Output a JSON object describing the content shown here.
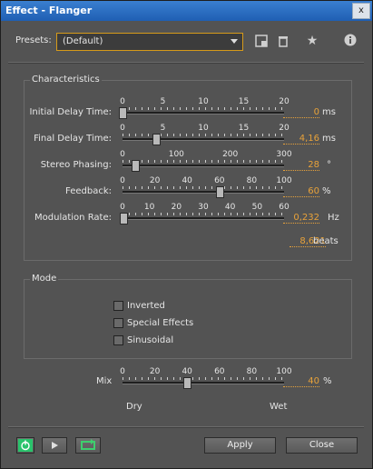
{
  "window": {
    "title": "Effect - Flanger",
    "close_glyph": "x"
  },
  "presets": {
    "label": "Presets:",
    "selected": "(Default)",
    "icons": [
      "save-preset-icon",
      "delete-preset-icon",
      "favorite-star-icon",
      "info-icon"
    ]
  },
  "characteristics": {
    "title": "Characteristics",
    "sliders": [
      {
        "label": "Initial Delay Time:",
        "ticks": [
          "0",
          "5",
          "10",
          "15",
          "20"
        ],
        "value": "0",
        "unit": "ms",
        "fraction": 0.0
      },
      {
        "label": "Final Delay Time:",
        "ticks": [
          "0",
          "5",
          "10",
          "15",
          "20"
        ],
        "value": "4,16",
        "unit": "ms",
        "fraction": 0.208
      },
      {
        "label": "Stereo Phasing:",
        "ticks": [
          "0",
          "100",
          "200",
          "300"
        ],
        "value": "28",
        "unit": "°",
        "fraction": 0.078
      },
      {
        "label": "Feedback:",
        "ticks": [
          "0",
          "20",
          "40",
          "60",
          "80",
          "100"
        ],
        "value": "60",
        "unit": "%",
        "fraction": 0.6
      },
      {
        "label": "Modulation Rate:",
        "ticks": [
          "0",
          "10",
          "20",
          "30",
          "40",
          "50",
          "60"
        ],
        "value": "0,232",
        "unit": "Hz",
        "fraction": 0.004
      }
    ],
    "beats_value": "8,621",
    "beats_unit": "beats"
  },
  "mode": {
    "title": "Mode",
    "options": [
      {
        "label": "Inverted",
        "checked": false
      },
      {
        "label": "Special Effects",
        "checked": false
      },
      {
        "label": "Sinusoidal",
        "checked": false
      }
    ]
  },
  "mix": {
    "label": "Mix",
    "ticks": [
      "0",
      "20",
      "40",
      "60",
      "80",
      "100"
    ],
    "value": "40",
    "unit": "%",
    "fraction": 0.4,
    "left": "Dry",
    "right": "Wet"
  },
  "footer": {
    "apply": "Apply",
    "close": "Close"
  },
  "colors": {
    "accent": "#e8a23a",
    "power": "#29c36b"
  }
}
